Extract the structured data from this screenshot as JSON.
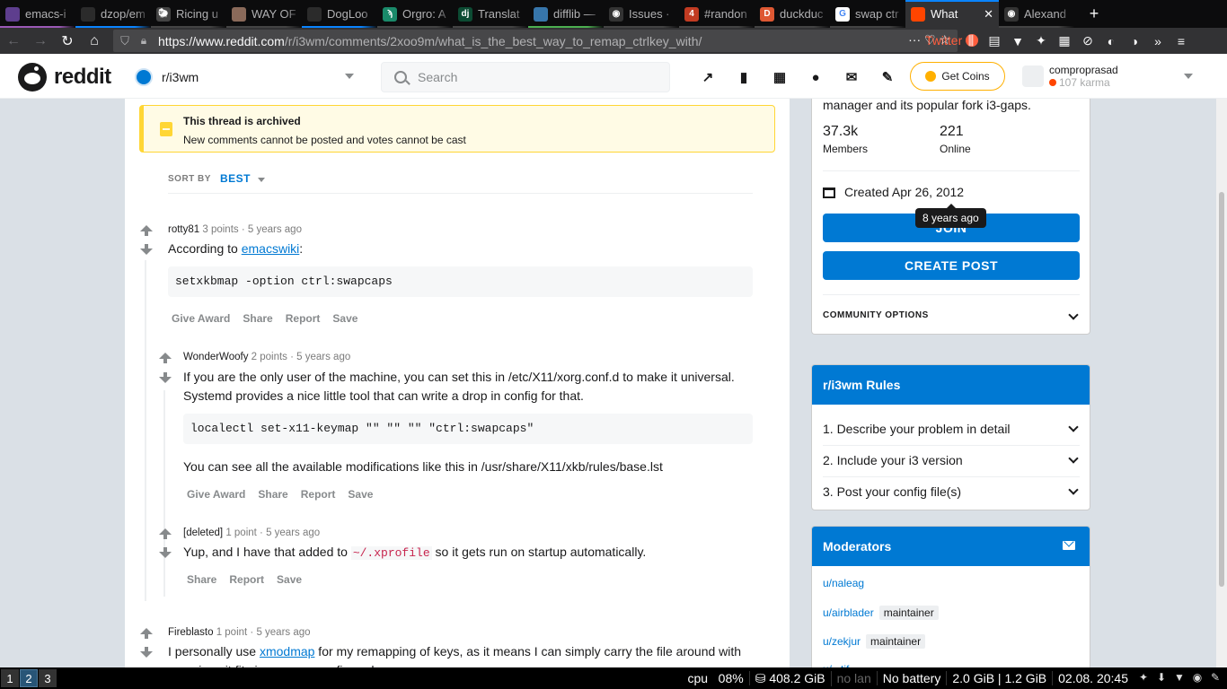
{
  "browser": {
    "tabs": [
      {
        "label": "emacs-i",
        "icon_color": "#5e3e8e",
        "bar_color": "#9b59b6",
        "icon_text": ""
      },
      {
        "label": "dzop/em",
        "icon_color": "#2b2b2b",
        "bar_color": "#0a84ff",
        "icon_text": ""
      },
      {
        "label": "Ricing u",
        "icon_color": "#444",
        "bar_color": "#444",
        "icon_text": "🐑"
      },
      {
        "label": "WAY OF",
        "icon_color": "#8a6a5a",
        "bar_color": "#444",
        "icon_text": ""
      },
      {
        "label": "DogLoo",
        "icon_color": "#2b2b2b",
        "bar_color": "#0a84ff",
        "icon_text": ""
      },
      {
        "label": "Orgro: A",
        "icon_color": "#1a8a6a",
        "bar_color": "#444",
        "icon_text": "ϡ"
      },
      {
        "label": "Translat",
        "icon_color": "#0c4b33",
        "bar_color": "#444",
        "icon_text": "dj"
      },
      {
        "label": "difflib —",
        "icon_color": "#3776ab",
        "bar_color": "#4caf50",
        "icon_text": ""
      },
      {
        "label": "Issues ·",
        "icon_color": "#333",
        "bar_color": "#444",
        "icon_text": "◉"
      },
      {
        "label": "#randon",
        "icon_color": "#c23b22",
        "bar_color": "#444",
        "icon_text": "4"
      },
      {
        "label": "duckduc",
        "icon_color": "#de5833",
        "bar_color": "#444",
        "icon_text": "D"
      },
      {
        "label": "swap ctr",
        "icon_color": "#ffffff",
        "bar_color": "#444",
        "icon_text": "G"
      },
      {
        "label": "What",
        "icon_color": "#ff4500",
        "bar_color": "#0a84ff",
        "icon_text": "",
        "active": true
      },
      {
        "label": "Alexand",
        "icon_color": "#333",
        "bar_color": "#444",
        "icon_text": "◉"
      }
    ],
    "tab_close": "✕",
    "new_tab": "+",
    "url_domain": "https://www.reddit.com",
    "url_path": "/r/i3wm/comments/2xoo9m/what_is_the_best_way_to_remap_ctrlkey_with/",
    "twitter_label": "Twitter",
    "nav": {
      "back": "←",
      "forward": "→",
      "reload": "↻",
      "home": "⌂"
    },
    "url_actions": "··· ♡ ☆",
    "tool_icons": [
      "⫼",
      "▤",
      "▼",
      "✦",
      "▦",
      "⊘",
      "◐",
      "◑",
      "»",
      "≡"
    ]
  },
  "header": {
    "wordmark": "reddit",
    "subreddit": "r/i3wm",
    "search_placeholder": "Search",
    "icons": [
      "↗",
      "▮",
      "▦",
      "●",
      "✉",
      "✎"
    ],
    "coins_label": "Get Coins",
    "username": "comproprasad",
    "karma": "107 karma"
  },
  "archive": {
    "title": "This thread is archived",
    "subtitle": "New comments cannot be posted and votes cannot be cast"
  },
  "sort": {
    "label": "SORT BY",
    "value": "BEST"
  },
  "comments": {
    "c1": {
      "author": "rotty81",
      "meta": " 3 points · 5 years ago",
      "text_before": "According to ",
      "link": "emacswiki",
      "text_after": ":",
      "code": "setxkbmap -option ctrl:swapcaps",
      "actions": [
        "Give Award",
        "Share",
        "Report",
        "Save"
      ]
    },
    "c2": {
      "author": "WonderWoofy",
      "meta": " 2 points · 5 years ago",
      "text1": "If you are the only user of the machine, you can set this in /etc/X11/xorg.conf.d to make it universal. Systemd provides a nice little tool that can write a drop in config for that.",
      "code": "localectl set-x11-keymap \"\" \"\" \"\" \"ctrl:swapcaps\"",
      "text2": "You can see all the available modifications like this in /usr/share/X11/xkb/rules/base.lst",
      "actions": [
        "Give Award",
        "Share",
        "Report",
        "Save"
      ]
    },
    "c3": {
      "author": "[deleted]",
      "meta": " 1 point · 5 years ago",
      "text_before": "Yup, and I have that added to ",
      "code_inline": "~/.xprofile",
      "text_after": " so it gets run on startup automatically.",
      "actions": [
        "Share",
        "Report",
        "Save"
      ]
    },
    "c4": {
      "author": "Fireblasto",
      "meta": " 1 point · 5 years ago",
      "text_before": "I personally use ",
      "link": "xmodmap",
      "text_after": " for my remapping of keys, as it means I can simply carry the file around with me, since it fits in my user config and"
    }
  },
  "sidebar": {
    "about_desc": "manager and its popular fork i3-gaps.",
    "members_value": "37.3k",
    "members_label": "Members",
    "online_value": "221",
    "online_label": "Online",
    "created": "Created Apr 26, 2012",
    "tooltip": "8 years ago",
    "join_label": "JOIN",
    "create_post_label": "CREATE POST",
    "community_options": "COMMUNITY OPTIONS",
    "rules_title": "r/i3wm Rules",
    "rules": [
      "1. Describe your problem in detail",
      "2. Include your i3 version",
      "3. Post your config file(s)"
    ],
    "moderators_title": "Moderators",
    "moderators": [
      {
        "name": "u/naleag",
        "flair": ""
      },
      {
        "name": "u/airblader",
        "flair": "maintainer"
      },
      {
        "name": "u/zekjur",
        "flair": "maintainer"
      },
      {
        "name": "u/...tif...",
        "flair": ""
      }
    ]
  },
  "statusbar": {
    "workspaces": [
      "1",
      "2",
      "3"
    ],
    "focused_workspace": "2",
    "cpu": "cpu   08%",
    "disk": "⛁ 408.2 GiB",
    "lan": "no lan",
    "battery": "No battery",
    "mem": "2.0 GiB | 1.2 GiB",
    "datetime": "02.08. 20:45",
    "tray": [
      "✦",
      "⬇",
      "▼",
      "◉",
      "✎"
    ]
  }
}
